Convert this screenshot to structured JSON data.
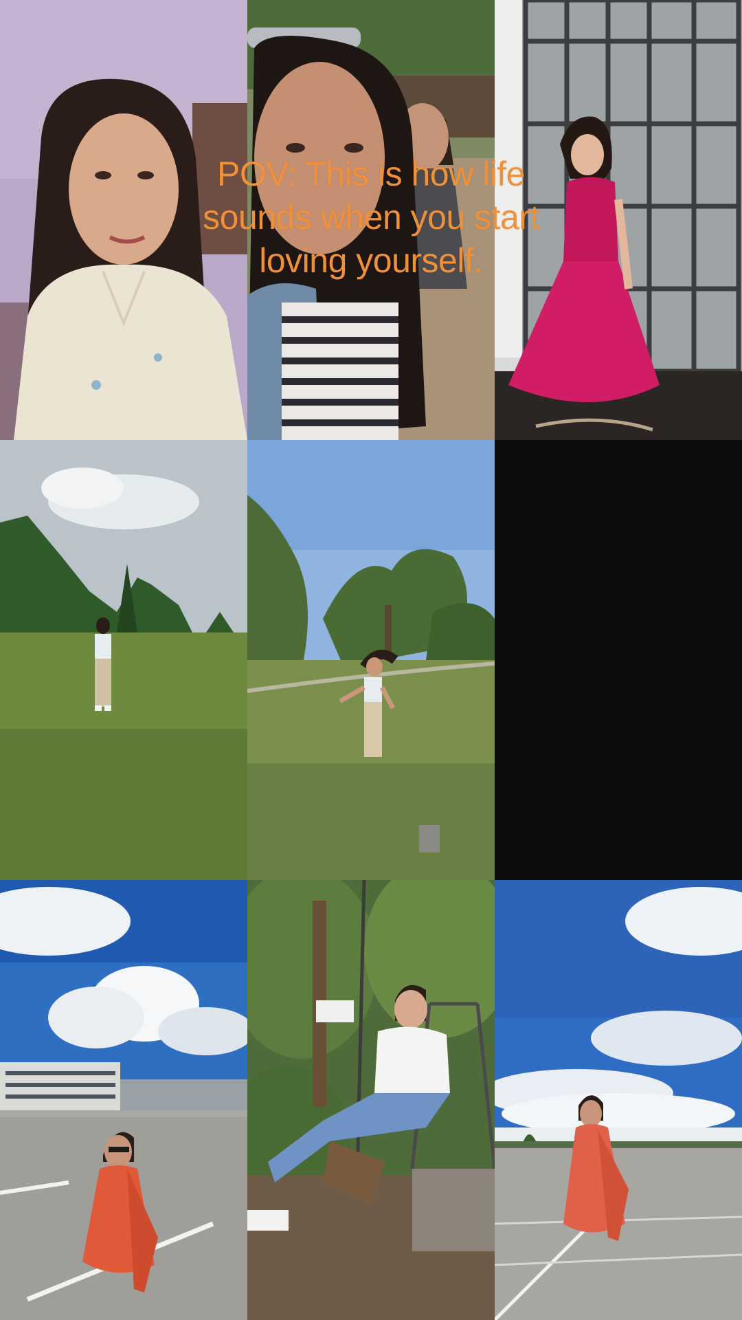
{
  "caption": {
    "text": "POV: This is how life sounds when you start loving yourself."
  },
  "tiles": [
    {
      "subject": "selfie-indoor-cream-top"
    },
    {
      "subject": "selfie-outdoor-with-companion"
    },
    {
      "subject": "pink-gown-by-glass-door"
    },
    {
      "subject": "walking-on-grassy-hill"
    },
    {
      "subject": "spinning-on-grassy-hill"
    },
    {
      "subject": "empty-black-tile"
    },
    {
      "subject": "orange-saree-parking-lot"
    },
    {
      "subject": "swing-in-garden"
    },
    {
      "subject": "orange-saree-under-blue-sky"
    }
  ],
  "colors": {
    "caption": "#f0913a",
    "background": "#0d0b0c"
  }
}
